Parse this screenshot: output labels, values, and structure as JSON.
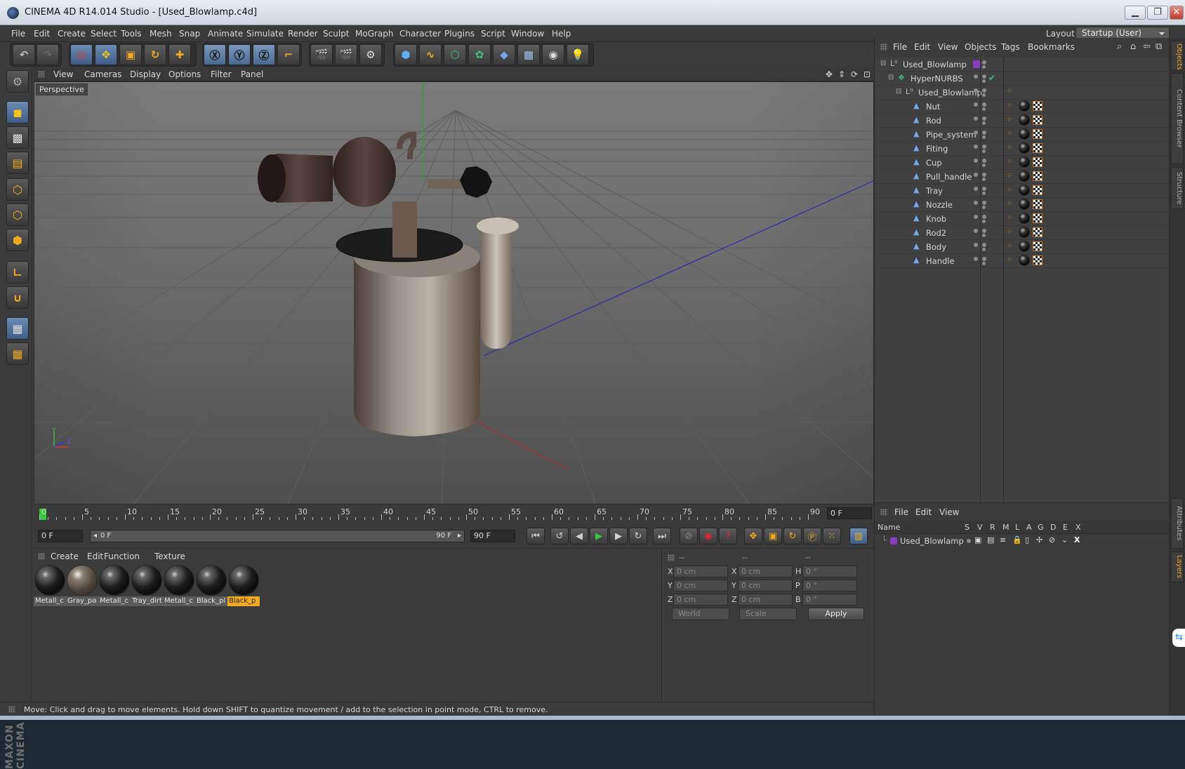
{
  "window": {
    "title": "CINEMA 4D R14.014 Studio - [Used_Blowlamp.c4d]",
    "btn_min": "▁",
    "btn_max": "❐",
    "btn_close": "✕"
  },
  "menu": [
    "File",
    "Edit",
    "Create",
    "Select",
    "Tools",
    "Mesh",
    "Snap",
    "Animate",
    "Simulate",
    "Render",
    "Sculpt",
    "MoGraph",
    "Character",
    "Plugins",
    "Script",
    "Window",
    "Help"
  ],
  "layout": {
    "label": "Layout:",
    "value": "Startup (User)"
  },
  "viewport": {
    "menu": [
      "View",
      "Cameras",
      "Display",
      "Options",
      "Filter",
      "Panel"
    ],
    "label": "Perspective",
    "axis_y": "Y",
    "axis_z": "Z"
  },
  "timeline": {
    "ticks": [
      "0",
      "5",
      "10",
      "15",
      "20",
      "25",
      "30",
      "35",
      "40",
      "45",
      "50",
      "55",
      "60",
      "65",
      "70",
      "75",
      "80",
      "85",
      "90"
    ],
    "current": "0 F",
    "start_field": "0 F",
    "range_start": "0 F",
    "range_end": "90 F",
    "end_field": "90 F"
  },
  "materials": {
    "menu": [
      "Create",
      "Edit",
      "Function",
      "Texture"
    ],
    "items": [
      "Metall_c",
      "Gray_pa",
      "Metall_c",
      "Tray_dirt",
      "Metall_c",
      "Black_pl",
      "Black_p"
    ],
    "selected_index": 6
  },
  "coords": {
    "headers": [
      "--",
      "--",
      "--"
    ],
    "rows": [
      {
        "a": "X",
        "av": "0 cm",
        "b": "X",
        "bv": "0 cm",
        "c": "H",
        "cv": "0 °"
      },
      {
        "a": "Y",
        "av": "0 cm",
        "b": "Y",
        "bv": "0 cm",
        "c": "P",
        "cv": "0 °"
      },
      {
        "a": "Z",
        "av": "0 cm",
        "b": "Z",
        "bv": "0 cm",
        "c": "B",
        "cv": "0 °"
      }
    ],
    "space": "World",
    "mode": "Scale",
    "apply": "Apply"
  },
  "status": "Move: Click and drag to move elements. Hold down SHIFT to quantize movement / add to the selection in point mode, CTRL to remove.",
  "objects": {
    "menu": [
      "File",
      "Edit",
      "View",
      "Objects",
      "Tags",
      "Bookmarks"
    ],
    "tree": [
      {
        "name": "Used_Blowlamp",
        "indent": 0,
        "icon": "null-object-icon"
      },
      {
        "name": "HyperNURBS",
        "indent": 1,
        "icon": "hypernurbs-icon"
      },
      {
        "name": "Used_Blowlamp",
        "indent": 2,
        "icon": "null-object-icon"
      },
      {
        "name": "Nut",
        "indent": 3,
        "icon": "polygon-object-icon"
      },
      {
        "name": "Rod",
        "indent": 3,
        "icon": "polygon-object-icon"
      },
      {
        "name": "Pipe_system",
        "indent": 3,
        "icon": "polygon-object-icon"
      },
      {
        "name": "Fiting",
        "indent": 3,
        "icon": "polygon-object-icon"
      },
      {
        "name": "Cup",
        "indent": 3,
        "icon": "polygon-object-icon"
      },
      {
        "name": "Pull_handle",
        "indent": 3,
        "icon": "polygon-object-icon"
      },
      {
        "name": "Tray",
        "indent": 3,
        "icon": "polygon-object-icon"
      },
      {
        "name": "Nozzle",
        "indent": 3,
        "icon": "polygon-object-icon"
      },
      {
        "name": "Knob",
        "indent": 3,
        "icon": "polygon-object-icon"
      },
      {
        "name": "Rod2",
        "indent": 3,
        "icon": "polygon-object-icon"
      },
      {
        "name": "Body",
        "indent": 3,
        "icon": "polygon-object-icon"
      },
      {
        "name": "Handle",
        "indent": 3,
        "icon": "polygon-object-icon"
      }
    ]
  },
  "layers": {
    "menu": [
      "File",
      "Edit",
      "View"
    ],
    "columns": [
      "Name",
      "S",
      "V",
      "R",
      "M",
      "L",
      "A",
      "G",
      "D",
      "E",
      "X"
    ],
    "rows": [
      {
        "name": "Used_Blowlamp",
        "color": "#8a3bbf"
      }
    ]
  },
  "side_tabs": [
    "Objects",
    "Content Browser",
    "Structure",
    "Attributes",
    "Layers"
  ],
  "brand": "MAXON CINEMA 4D",
  "colors": {
    "accent": "#f2a91f",
    "selection_blue": "#5d7fae",
    "layer_purple": "#8a3bbf"
  }
}
